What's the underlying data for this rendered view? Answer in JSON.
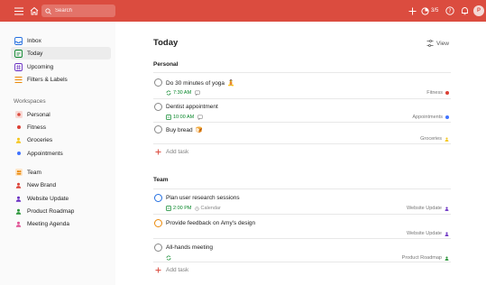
{
  "header": {
    "search_placeholder": "Search",
    "karma_text": "3/5",
    "avatar_initial": "P",
    "colors": {
      "bar": "#db4c3f",
      "icon": "#ffffff"
    }
  },
  "sidebar": {
    "nav": [
      {
        "label": "Inbox",
        "icon": "inbox-icon",
        "color": "#246fe0"
      },
      {
        "label": "Today",
        "icon": "calendar-today-icon",
        "color": "#058527",
        "active": true
      },
      {
        "label": "Upcoming",
        "icon": "calendar-upcoming-icon",
        "color": "#692fc2"
      },
      {
        "label": "Filters & Labels",
        "icon": "filters-icon",
        "color": "#eb8909"
      }
    ],
    "workspaces_heading": "Workspaces",
    "workspaces": [
      {
        "label": "Personal",
        "color": "#db4c3f"
      },
      {
        "label": "Fitness",
        "color": "#db4035"
      },
      {
        "label": "Groceries",
        "color": "#f5c518"
      },
      {
        "label": "Appointments",
        "color": "#4073ff"
      }
    ],
    "team": {
      "label": "Team",
      "color": "#eb8909"
    },
    "team_projects": [
      {
        "label": "New Brand",
        "color": "#db4035"
      },
      {
        "label": "Website Update",
        "color": "#692fc2"
      },
      {
        "label": "Product Roadmap",
        "color": "#299438"
      },
      {
        "label": "Meeting Agenda",
        "color": "#e05194"
      }
    ]
  },
  "main": {
    "title": "Today",
    "view_label": "View",
    "add_task_label": "Add task",
    "sections": [
      {
        "title": "Personal",
        "tasks": [
          {
            "title": "Do 30 minutes of yoga",
            "emoji": "🧘",
            "time": "7:30 AM",
            "time_icon": "recurring-icon",
            "sub_icon": "comment-icon",
            "project": "Fitness",
            "project_color": "#db4035",
            "check_color": "#888888"
          },
          {
            "title": "Dentist appointment",
            "time": "10:00 AM",
            "time_icon": "calendar-icon",
            "sub_icon": "comment-icon",
            "project": "Appointments",
            "project_color": "#4073ff",
            "check_color": "#888888"
          },
          {
            "title": "Buy bread",
            "emoji": "🍞",
            "project": "Groceries",
            "project_color": "#f5c518",
            "check_color": "#888888"
          }
        ]
      },
      {
        "title": "Team",
        "tasks": [
          {
            "title": "Plan user research sessions",
            "time": "2:00 PM",
            "time_icon": "calendar-icon",
            "sub": "Calendar",
            "project": "Website Update",
            "project_color": "#692fc2",
            "check_color": "#246fe0"
          },
          {
            "title": "Provide feedback on Amy's design",
            "project": "Website Update",
            "project_color": "#692fc2",
            "check_color": "#eb8909"
          },
          {
            "title": "All-hands meeting",
            "time_icon": "recurring-icon",
            "project": "Product Roadmap",
            "project_color": "#299438",
            "check_color": "#888888"
          }
        ]
      }
    ]
  }
}
